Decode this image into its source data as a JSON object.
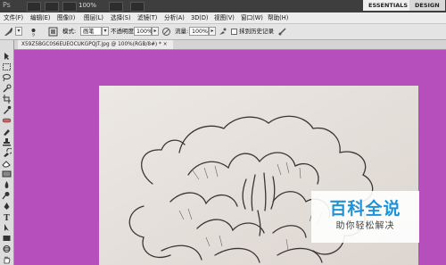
{
  "app": {
    "logo": "Ps",
    "zoom": "100%",
    "workspaces": [
      "ESSENTIALS",
      "DESIGN"
    ]
  },
  "menu": [
    "文件(F)",
    "编辑(E)",
    "图像(I)",
    "图层(L)",
    "选择(S)",
    "滤镜(T)",
    "分析(A)",
    "3D(D)",
    "视图(V)",
    "窗口(W)",
    "帮助(H)"
  ],
  "options": {
    "mode_label": "模式:",
    "mode_value": "画笔",
    "opacity_label": "不透明度:",
    "opacity_value": "100%",
    "flow_label": "流量:",
    "flow_value": "100%",
    "history_label": "抹到历史记录"
  },
  "document": {
    "tab_title": "X59Z5BGC0S6EUEOCUKGPQJT.jpg @ 100%(RGB/8#) * ×"
  },
  "watermark": {
    "title": "百科全说",
    "subtitle": "助你轻松解决"
  },
  "colors": {
    "canvas_bg": "#b64fbc",
    "watermark_blue": "#1f93d6"
  }
}
